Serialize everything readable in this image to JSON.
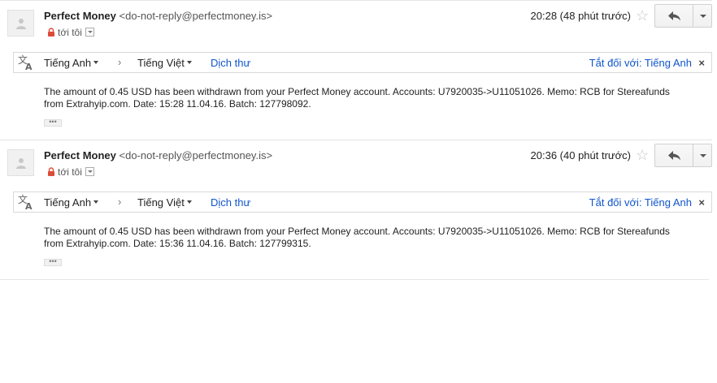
{
  "messages": [
    {
      "sender_name": "Perfect Money",
      "sender_email": "<do-not-reply@perfectmoney.is>",
      "recipient": "tới tôi",
      "time": "20:28 (48 phút trước)",
      "translate_bar": {
        "source_lang": "Tiếng Anh",
        "arrow": "›",
        "target_lang": "Tiếng Việt",
        "translate_link": "Dịch thư",
        "turn_off": "Tắt đối với: Tiếng Anh",
        "close": "×"
      },
      "body": "The amount of 0.45 USD has been withdrawn from your Perfect Money account. Accounts: U7920035->U11051026. Memo: RCB for Stereafunds from Extrahyip.com. Date: 15:28 11.04.16. Batch: 127798092.",
      "ellipsis": "•••"
    },
    {
      "sender_name": "Perfect Money",
      "sender_email": "<do-not-reply@perfectmoney.is>",
      "recipient": "tới tôi",
      "time": "20:36 (40 phút trước)",
      "translate_bar": {
        "source_lang": "Tiếng Anh",
        "arrow": "›",
        "target_lang": "Tiếng Việt",
        "translate_link": "Dịch thư",
        "turn_off": "Tắt đối với: Tiếng Anh",
        "close": "×"
      },
      "body": "The amount of 0.45 USD has been withdrawn from your Perfect Money account. Accounts: U7920035->U11051026. Memo: RCB for Stereafunds from Extrahyip.com. Date: 15:36 11.04.16. Batch: 127799315.",
      "ellipsis": "•••"
    }
  ],
  "icons": {
    "avatar": "person-icon",
    "lock": "lock-icon",
    "star": "star-icon",
    "reply": "reply-icon",
    "more": "chevron-down-icon",
    "translate": "translate-icon"
  },
  "colors": {
    "link": "#1155cc",
    "lock": "#dd4b39",
    "text": "#222222"
  }
}
